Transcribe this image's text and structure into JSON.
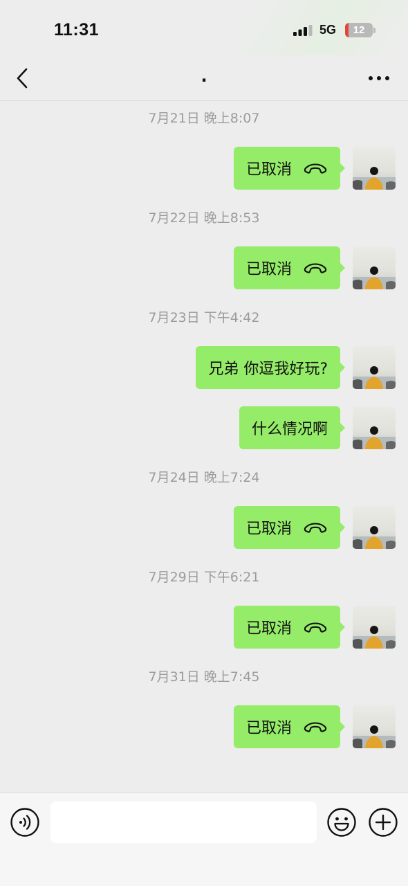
{
  "status_bar": {
    "time": "11:31",
    "network": "5G",
    "battery": "12",
    "battery_level_percent": 12,
    "battery_charging": true
  },
  "nav": {
    "title": ".",
    "icons": {
      "back": "chevron-left-icon",
      "more": "more-dots-icon"
    }
  },
  "messages": [
    {
      "type": "timestamp",
      "text": "7月21日 晚上8:07"
    },
    {
      "type": "call",
      "text": "已取消",
      "direction": "outgoing"
    },
    {
      "type": "timestamp",
      "text": "7月22日 晚上8:53"
    },
    {
      "type": "call",
      "text": "已取消",
      "direction": "outgoing"
    },
    {
      "type": "timestamp",
      "text": "7月23日 下午4:42"
    },
    {
      "type": "text",
      "text": "兄弟 你逗我好玩?",
      "direction": "outgoing"
    },
    {
      "type": "text",
      "text": "什么情况啊",
      "direction": "outgoing"
    },
    {
      "type": "timestamp",
      "text": "7月24日 晚上7:24"
    },
    {
      "type": "call",
      "text": "已取消",
      "direction": "outgoing"
    },
    {
      "type": "timestamp",
      "text": "7月29日 下午6:21"
    },
    {
      "type": "call",
      "text": "已取消",
      "direction": "outgoing"
    },
    {
      "type": "timestamp",
      "text": "7月31日 晚上7:45"
    },
    {
      "type": "call",
      "text": "已取消",
      "direction": "outgoing"
    }
  ],
  "input_bar": {
    "value": "",
    "placeholder": "",
    "icons": {
      "voice": "voice-icon",
      "emoji": "emoji-icon",
      "plus": "plus-icon"
    }
  },
  "colors": {
    "background": "#ededed",
    "bubble_green": "#95ec69",
    "timestamp_gray": "#9b9b9b"
  }
}
